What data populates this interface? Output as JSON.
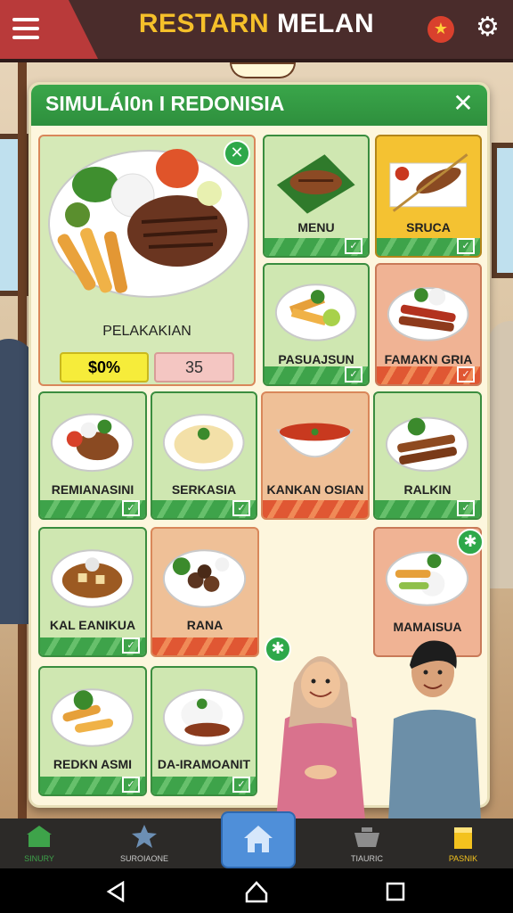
{
  "header": {
    "title_part1": "RESTARN",
    "title_part2": "MELAN",
    "menu_icon": "hamburger-icon",
    "fire_icon": "flame-badge-icon",
    "settings_icon": "gear-icon"
  },
  "panel": {
    "title": "SIMULÁI0n I REDONISIA",
    "close_icon": "close-icon",
    "featured": {
      "name": "PELAKAKIAN",
      "price_primary": "$0%",
      "price_secondary": "35",
      "badge_icon": "close-badge-icon"
    },
    "dishes": [
      {
        "label": "MENU"
      },
      {
        "label": "SRUCA"
      },
      {
        "label": "PASUAJSUN"
      },
      {
        "label": "FAMAKN GRIA"
      },
      {
        "label": "REMIANASINI"
      },
      {
        "label": "SERKASIA"
      },
      {
        "label": "KANKAN OSIAN"
      },
      {
        "label": "RALKIN"
      },
      {
        "label": "KAL EANIKUA"
      },
      {
        "label": "RANA"
      },
      {
        "label": "MAMAISUA"
      },
      {
        "label": "REDKN ASMI"
      },
      {
        "label": "DA-IRAMOANIT"
      }
    ]
  },
  "bottom_nav": [
    {
      "label": "SINURY",
      "icon": "shop-icon"
    },
    {
      "label": "SUROIAONE",
      "icon": "star-icon"
    },
    {
      "label": "",
      "icon": "home-icon"
    },
    {
      "label": "TIAURIC",
      "icon": "cooking-pot-icon"
    },
    {
      "label": "PASNIK",
      "icon": "gold-bar-icon"
    }
  ],
  "system_nav": {
    "back_icon": "back-triangle-icon",
    "home_icon": "home-circle-icon",
    "recents_icon": "recents-square-icon"
  },
  "colors": {
    "accent_green": "#2e8f3d",
    "title_gold": "#f5c02a",
    "topbar": "#4a2c2b",
    "nav_active_home": "#4f8fd9"
  }
}
